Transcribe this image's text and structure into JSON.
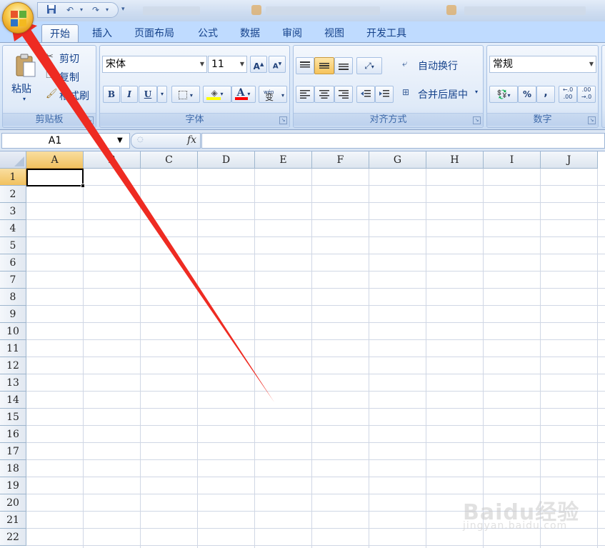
{
  "tabs": [
    "开始",
    "插入",
    "页面布局",
    "公式",
    "数据",
    "审阅",
    "视图",
    "开发工具"
  ],
  "clipboard": {
    "paste": "粘贴",
    "cut": "剪切",
    "copy": "复制",
    "format_painter": "格式刷",
    "group_label": "剪贴板"
  },
  "font": {
    "name": "宋体",
    "size": "11",
    "bold": "B",
    "italic": "I",
    "underline": "U",
    "font_color_glyph": "A",
    "phonetic": "变",
    "phonetic_top": "wén",
    "group_label": "字体"
  },
  "alignment": {
    "wrap_text": "自动换行",
    "merge_center": "合并后居中",
    "group_label": "对齐方式"
  },
  "number": {
    "format": "常规",
    "percent": "%",
    "comma": ",",
    "group_label": "数字"
  },
  "formula_bar": {
    "name_box": "A1",
    "fx": "fx"
  },
  "grid": {
    "columns": [
      "A",
      "B",
      "C",
      "D",
      "E",
      "F",
      "G",
      "H",
      "I",
      "J"
    ],
    "rows": [
      "1",
      "2",
      "3",
      "4",
      "5",
      "6",
      "7",
      "8",
      "9",
      "10",
      "11",
      "12",
      "13",
      "14",
      "15",
      "16",
      "17",
      "18",
      "19",
      "20",
      "21",
      "22"
    ],
    "active_column": "A",
    "active_row": "1"
  },
  "watermark": {
    "brand": "Baidu经验",
    "url": "jingyan.baidu.com"
  },
  "colors": {
    "accent": "#15428b",
    "annotation_arrow": "#ee2b22",
    "selected_header": "#f1c15f"
  }
}
